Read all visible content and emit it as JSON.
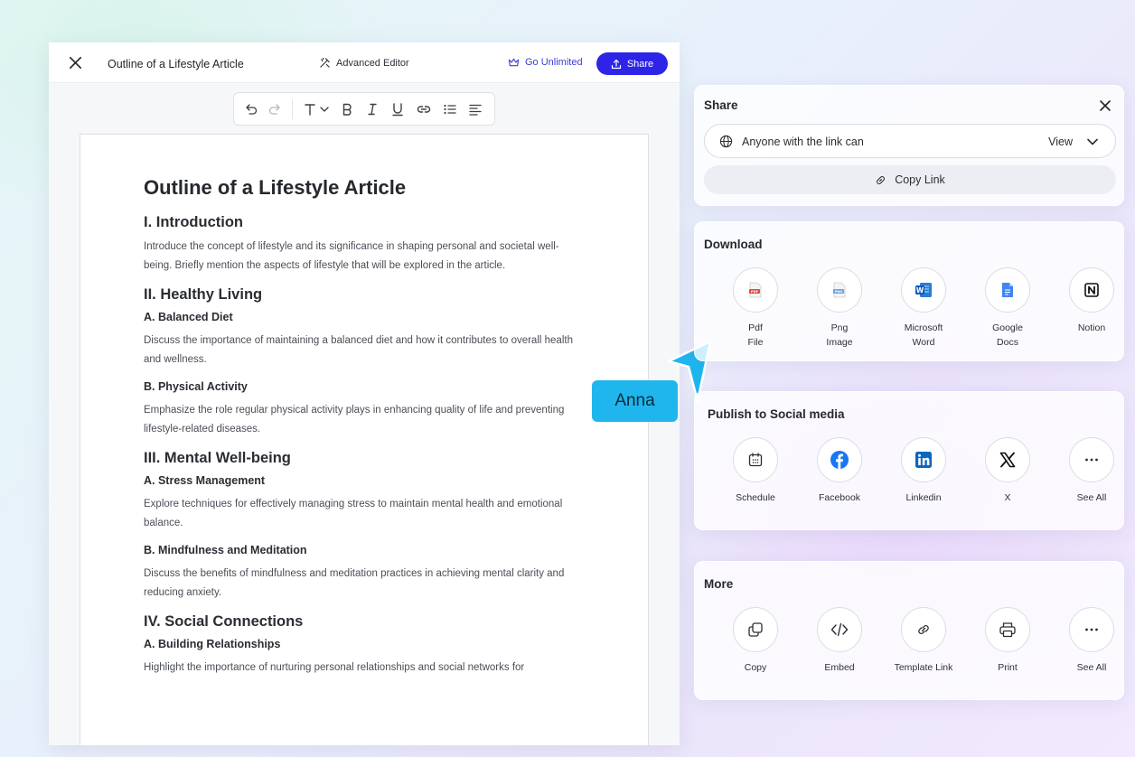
{
  "editor": {
    "doc_name": "Outline of a Lifestyle Article",
    "advanced_editor": "Advanced Editor",
    "go_unlimited": "Go Unlimited",
    "share": "Share"
  },
  "document": {
    "title": "Outline of a Lifestyle Article",
    "s1_heading": "I. Introduction",
    "s1_text": "Introduce the concept of lifestyle and its significance in shaping personal and societal well-being. Briefly mention the aspects of lifestyle that will be explored in the article.",
    "s2_heading": "II. Healthy Living",
    "s2a_heading": "A. Balanced Diet",
    "s2a_text": "Discuss the importance of maintaining a balanced diet and how it contributes to overall health and wellness.",
    "s2b_heading": "B. Physical Activity",
    "s2b_text": "Emphasize the role regular physical activity plays in enhancing quality of life and preventing lifestyle-related diseases.",
    "s3_heading": "III. Mental Well-being",
    "s3a_heading": "A. Stress Management",
    "s3a_text": "Explore techniques for effectively managing stress to maintain mental health and emotional balance.",
    "s3b_heading": "B. Mindfulness and Meditation",
    "s3b_text": "Discuss the benefits of mindfulness and meditation practices in achieving mental clarity and reducing anxiety.",
    "s4_heading": "IV. Social Connections",
    "s4a_heading": "A. Building Relationships",
    "s4a_text": "Highlight the importance of nurturing personal relationships and social networks for"
  },
  "collaborator": {
    "name": "Anna"
  },
  "share_panel": {
    "title": "Share",
    "access_text": "Anyone with the link can",
    "access_value": "View",
    "copy_link": "Copy Link"
  },
  "download": {
    "title": "Download",
    "items": [
      {
        "label": "Pdf",
        "label2": "File",
        "icon": "pdf-file-icon"
      },
      {
        "label": "Png",
        "label2": "Image",
        "icon": "png-image-icon"
      },
      {
        "label": "Microsoft",
        "label2": "Word",
        "icon": "microsoft-word-icon"
      },
      {
        "label": "Google",
        "label2": "Docs",
        "icon": "google-docs-icon"
      },
      {
        "label": "Notion",
        "label2": "",
        "icon": "notion-icon"
      }
    ]
  },
  "social": {
    "title": "Publish to Social media",
    "items": [
      {
        "label": "Schedule",
        "icon": "calendar-icon"
      },
      {
        "label": "Facebook",
        "icon": "facebook-icon"
      },
      {
        "label": "Linkedin",
        "icon": "linkedin-icon"
      },
      {
        "label": "X",
        "icon": "x-icon"
      },
      {
        "label": "See All",
        "icon": "more-icon"
      }
    ]
  },
  "more": {
    "title": "More",
    "items": [
      {
        "label": "Copy",
        "icon": "copy-icon"
      },
      {
        "label": "Embed",
        "icon": "embed-code-icon"
      },
      {
        "label": "Template Link",
        "icon": "link-icon"
      },
      {
        "label": "Print",
        "icon": "printer-icon"
      },
      {
        "label": "See All",
        "icon": "more-icon"
      }
    ]
  },
  "colors": {
    "share_button": "#2d24e8",
    "go_unlimited": "#3b3bd6",
    "name_tag": "#1fb6ee",
    "cursor": "#1fb6ee"
  }
}
